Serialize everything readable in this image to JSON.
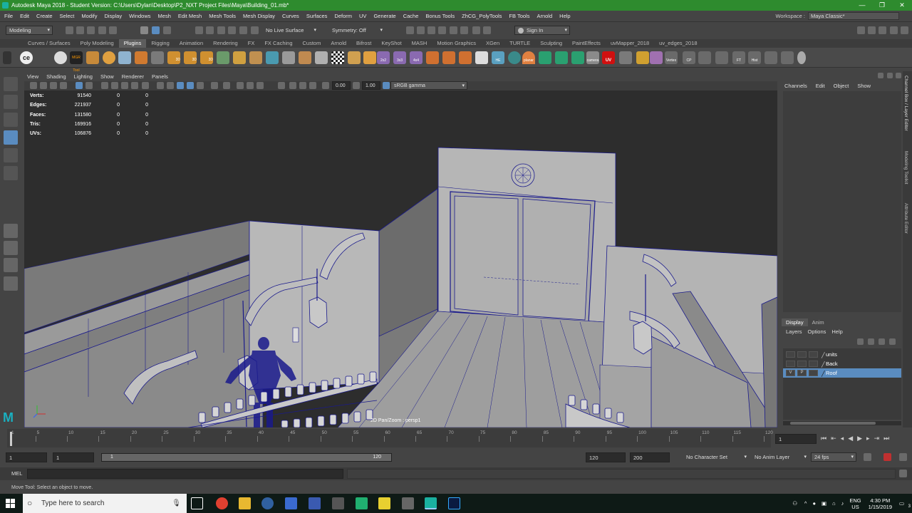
{
  "window": {
    "title": "Autodesk Maya 2018 - Student Version: C:\\Users\\Dylan\\Desktop\\P2_NXT Project Files\\Maya\\Building_01.mb*",
    "controls": [
      "—",
      "❐",
      "✕"
    ]
  },
  "menubar": {
    "items": [
      "File",
      "Edit",
      "Create",
      "Select",
      "Modify",
      "Display",
      "Windows",
      "Mesh",
      "Edit Mesh",
      "Mesh Tools",
      "Mesh Display",
      "Curves",
      "Surfaces",
      "Deform",
      "UV",
      "Generate",
      "Cache",
      "Bonus Tools",
      "ZhCG_PolyTools",
      "FB Tools",
      "Arnold",
      "Help"
    ],
    "workspace_label": "Workspace :",
    "workspace_value": "Maya Classic*"
  },
  "statusline": {
    "mode": "Modeling",
    "live_surface": "No Live Surface",
    "symmetry": "Symmetry: Off",
    "sign_in": "Sign In"
  },
  "shelf": {
    "tabs": [
      "Curves / Surfaces",
      "Poly Modeling",
      "Plugins",
      "Rigging",
      "Animation",
      "Rendering",
      "FX",
      "FX Caching",
      "Custom",
      "Arnold",
      "Bifrost",
      "KeyShot",
      "MASH",
      "Motion Graphics",
      "XGen",
      "TURTLE",
      "Sculpting",
      "PaintEffects",
      "uvMapper_2018",
      "uv_edges_2018"
    ],
    "active_tab": "Plugins",
    "icon_labels": [
      "MGR Tool",
      "3D",
      "3D",
      "3D",
      "2x2",
      "3x3",
      "4x4",
      "HE",
      "planar",
      "camera",
      "UV",
      "Vertex",
      "CP",
      "FT",
      "Hist"
    ]
  },
  "viewport": {
    "menu": [
      "View",
      "Shading",
      "Lighting",
      "Show",
      "Renderer",
      "Panels"
    ],
    "exposure": "0.00",
    "gamma": "1.00",
    "color_space": "sRGB gamma",
    "hud": [
      {
        "label": "Verts:",
        "value": "91540",
        "a": "0",
        "b": "0"
      },
      {
        "label": "Edges:",
        "value": "221937",
        "a": "0",
        "b": "0"
      },
      {
        "label": "Faces:",
        "value": "131580",
        "a": "0",
        "b": "0"
      },
      {
        "label": "Tris:",
        "value": "169916",
        "a": "0",
        "b": "0"
      },
      {
        "label": "UVs:",
        "value": "106876",
        "a": "0",
        "b": "0"
      }
    ],
    "camera_label": "2D Pan/Zoom : persp1"
  },
  "channelbox": {
    "menu": [
      "Channels",
      "Edit",
      "Object",
      "Show"
    ]
  },
  "side_tabs": [
    "Channel Box / Layer Editor",
    "Modeling Toolkit",
    "Attribute Editor"
  ],
  "layers": {
    "tabs": [
      "Display",
      "Anim"
    ],
    "active_tab": "Display",
    "menu": [
      "Layers",
      "Options",
      "Help"
    ],
    "rows": [
      {
        "name": "units",
        "selected": false,
        "v": "",
        "p": ""
      },
      {
        "name": "Back",
        "selected": false,
        "v": "",
        "p": ""
      },
      {
        "name": "Roof",
        "selected": true,
        "v": "V",
        "p": "P"
      }
    ]
  },
  "timeline": {
    "tick_labels": [
      "1",
      "5",
      "10",
      "15",
      "20",
      "25",
      "30",
      "35",
      "40",
      "45",
      "50",
      "55",
      "60",
      "65",
      "70",
      "75",
      "80",
      "85",
      "90",
      "95",
      "100",
      "105",
      "110",
      "115",
      "120"
    ],
    "current_frame": "1"
  },
  "range": {
    "start": "1",
    "start2": "1",
    "slider_start": "1",
    "slider_end": "120",
    "end": "120",
    "max": "200",
    "character_set": "No Character Set",
    "anim_layer": "No Anim Layer",
    "fps": "24 fps"
  },
  "mel": {
    "label": "MEL"
  },
  "helpline": "Move Tool: Select an object to move.",
  "taskbar": {
    "search_placeholder": "Type here to search",
    "lang": "ENG",
    "region": "US",
    "time": "4:30 PM",
    "date": "1/15/2019",
    "notifications": "3"
  },
  "colors": {
    "titlebar": "#2e8b2e",
    "selection": "#5a8cc0",
    "wire": "#1a1a8c"
  }
}
